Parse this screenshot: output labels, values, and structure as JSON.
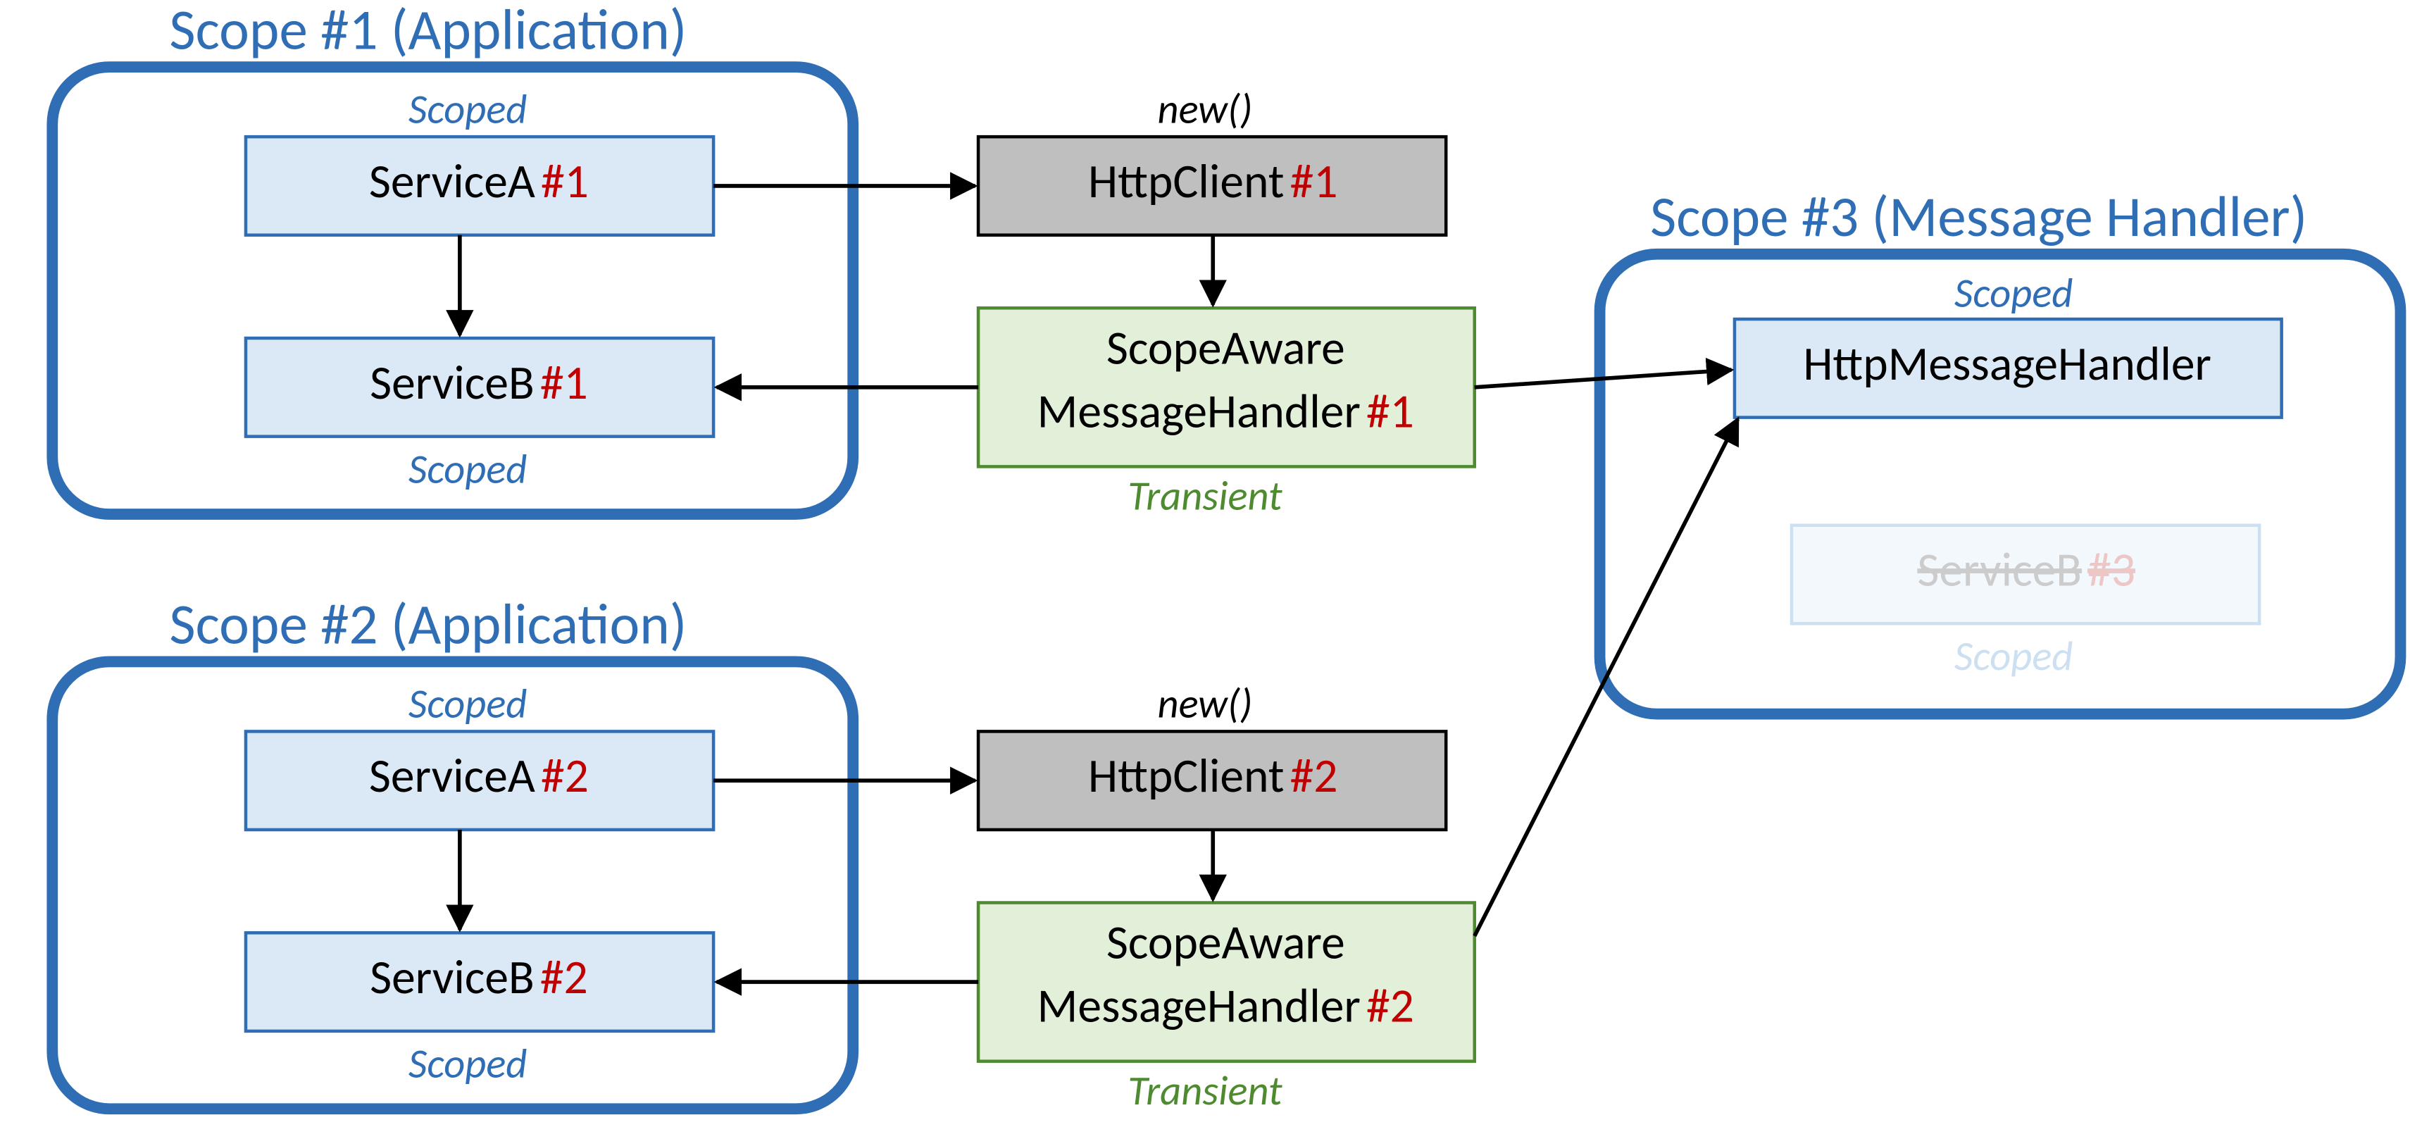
{
  "scope1": {
    "title": "Scope #1 (Application)",
    "serviceA": {
      "name": "ServiceA",
      "tag": "#1",
      "lifecycle": "Scoped"
    },
    "serviceB": {
      "name": "ServiceB",
      "tag": "#1",
      "lifecycle": "Scoped"
    }
  },
  "scope2": {
    "title": "Scope #2 (Application)",
    "serviceA": {
      "name": "ServiceA",
      "tag": "#2",
      "lifecycle": "Scoped"
    },
    "serviceB": {
      "name": "ServiceB",
      "tag": "#2",
      "lifecycle": "Scoped"
    }
  },
  "httpClient1": {
    "name": "HttpClient",
    "tag": "#1",
    "annotation": "new()"
  },
  "httpClient2": {
    "name": "HttpClient",
    "tag": "#2",
    "annotation": "new()"
  },
  "scopeAware1": {
    "line1": "ScopeAware",
    "line2": "MessageHandler",
    "tag": "#1",
    "lifecycle": "Transient"
  },
  "scopeAware2": {
    "line1": "ScopeAware",
    "line2": "MessageHandler",
    "tag": "#2",
    "lifecycle": "Transient"
  },
  "scope3": {
    "title": "Scope #3 (Message Handler)",
    "handler": {
      "name": "HttpMessageHandler",
      "lifecycle": "Scoped"
    },
    "ghostServiceB": {
      "name": "ServiceB",
      "tag": "#3",
      "lifecycle": "Scoped"
    }
  }
}
